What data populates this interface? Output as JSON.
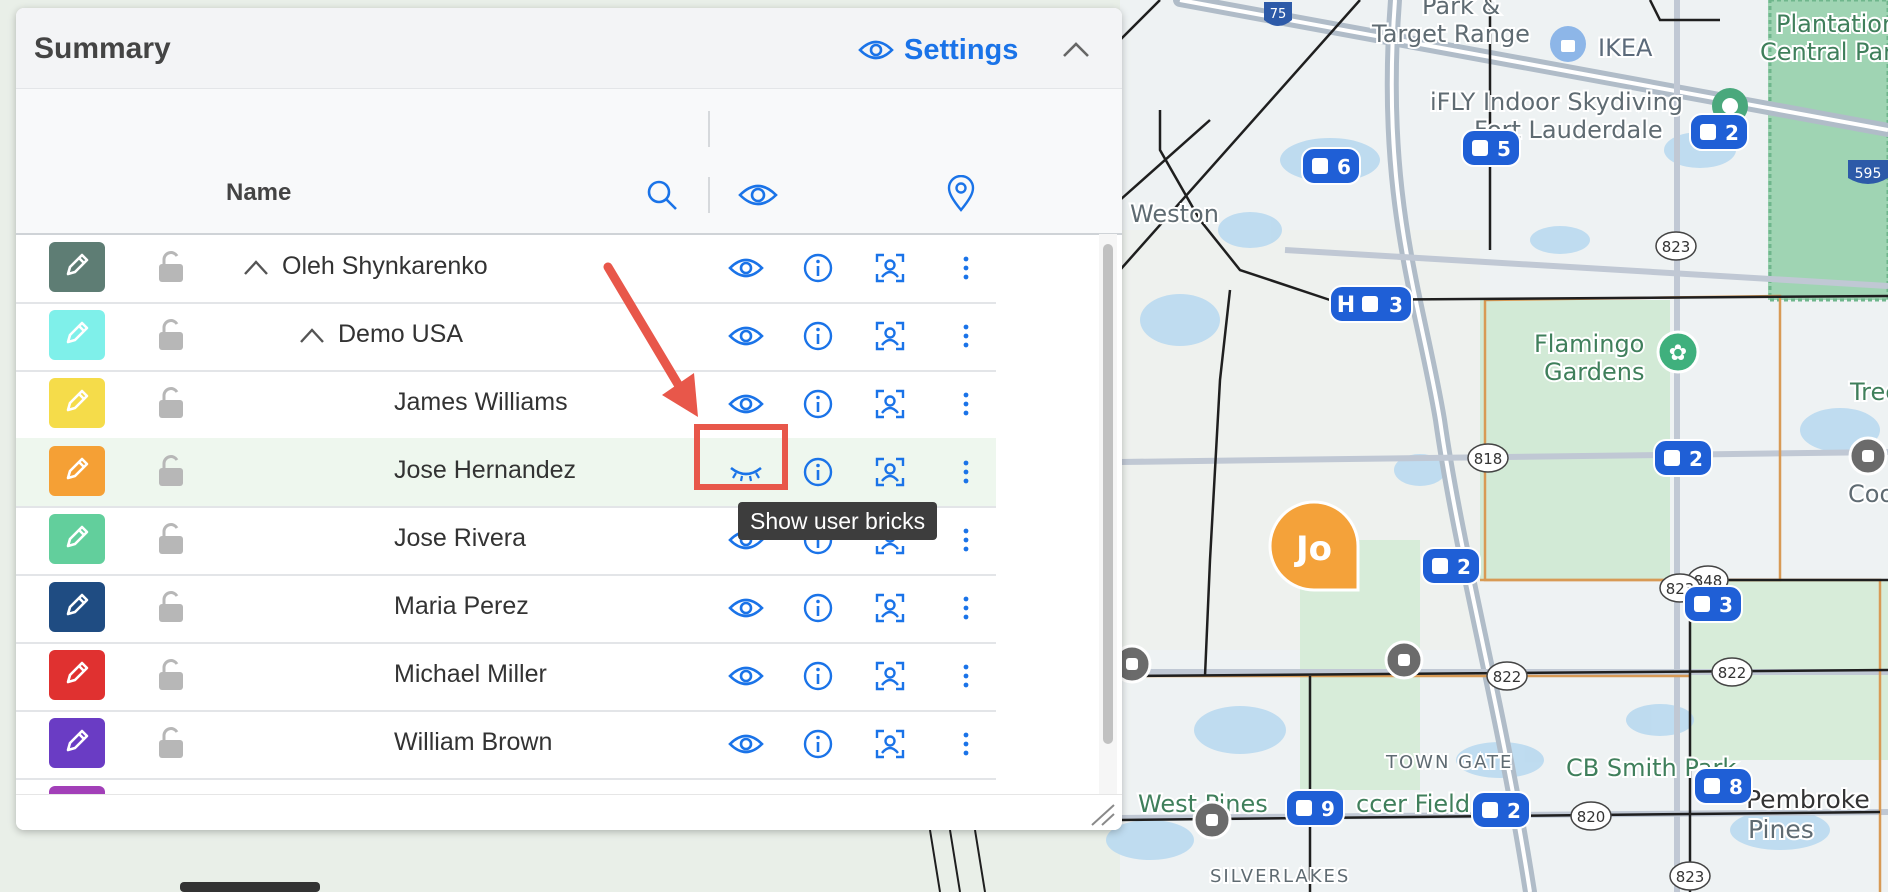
{
  "panel": {
    "title": "Summary",
    "settings_label": "Settings",
    "column_name_label": "Name"
  },
  "rows": [
    {
      "name": "Oleh Shynkarenko",
      "color": "#5e7d74",
      "expandable": true,
      "expanded": true,
      "eye": "open"
    },
    {
      "name": "Demo USA",
      "color": "#7ff0ea",
      "expandable": true,
      "expanded": true,
      "eye": "open"
    },
    {
      "name": "James Williams",
      "color": "#f5dc4a",
      "expandable": false,
      "eye": "open"
    },
    {
      "name": "Jose Hernandez",
      "color": "#f5a035",
      "expandable": false,
      "eye": "closed",
      "highlighted": true
    },
    {
      "name": "Jose Rivera",
      "color": "#62cf9c",
      "expandable": false,
      "eye": "open"
    },
    {
      "name": "Maria Perez",
      "color": "#1f4c82",
      "expandable": false,
      "eye": "open"
    },
    {
      "name": "Michael Miller",
      "color": "#e03130",
      "expandable": false,
      "eye": "open"
    },
    {
      "name": "William Brown",
      "color": "#6a3cc4",
      "expandable": false,
      "eye": "open"
    },
    {
      "name": "",
      "color": "#a23fb8",
      "expandable": false,
      "eye": "open"
    }
  ],
  "tooltip": "Show user bricks",
  "map": {
    "labels": {
      "weston": "Weston",
      "ikea": "IKEA",
      "target_range": "Target Range",
      "park": "Park &",
      "ifly1": "iFLY Indoor Skydiving",
      "ifly2": "Fort Lauderdale",
      "plantation1": "Plantation",
      "plantation2": "Central Park",
      "flamingo1": "Flamingo",
      "flamingo2": "Gardens",
      "town_gate": "TOWN GATE",
      "cb_smith": "CB Smith Park",
      "pembroke1": "Pembroke",
      "pembroke2": "Pines",
      "west_pines": "West Pines",
      "soccer_field": "ccer Field",
      "silverlakes": "SILVERLAKES",
      "tree": "Tree",
      "coo": "Coo",
      "user_marker": "Jo"
    },
    "routes": [
      "75",
      "595",
      "823",
      "818",
      "848",
      "822",
      "820",
      "823",
      "822",
      "823"
    ],
    "cluster_counts": [
      "6",
      "5",
      "2",
      "3",
      "2",
      "2",
      "3",
      "9",
      "2",
      "8"
    ],
    "hospital_glyph": "H"
  },
  "colors": {
    "accent": "#1a73e8",
    "annotation": "#e8574a",
    "marker_blue": "#1f5fd6",
    "user_marker": "#f4a23a"
  }
}
